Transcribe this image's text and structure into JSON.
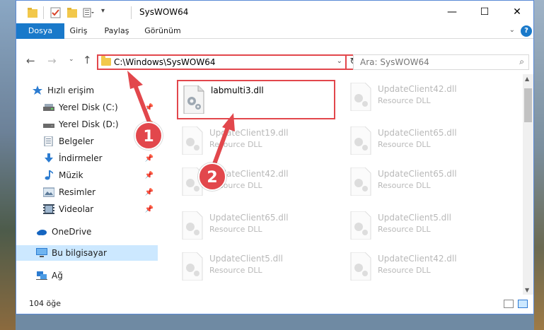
{
  "window": {
    "title": "SysWOW64"
  },
  "ribbon": {
    "tabs": [
      "Dosya",
      "Giriş",
      "Paylaş",
      "Görünüm"
    ],
    "help": "?"
  },
  "address": {
    "path": "C:\\Windows\\SysWOW64"
  },
  "search": {
    "placeholder": "Ara: SysWOW64"
  },
  "sidebar": {
    "items": [
      {
        "label": "Hızlı erişim",
        "icon": "star-icon"
      },
      {
        "label": "Yerel Disk (C:)",
        "icon": "drive-icon",
        "pinned": true
      },
      {
        "label": "Yerel Disk (D:)",
        "icon": "drive-icon",
        "pinned": true
      },
      {
        "label": "Belgeler",
        "icon": "documents-icon",
        "pinned": true
      },
      {
        "label": "İndirmeler",
        "icon": "download-icon",
        "pinned": true
      },
      {
        "label": "Müzik",
        "icon": "music-icon",
        "pinned": true
      },
      {
        "label": "Resimler",
        "icon": "pictures-icon",
        "pinned": true
      },
      {
        "label": "Videolar",
        "icon": "videos-icon",
        "pinned": true
      },
      {
        "label": "OneDrive",
        "icon": "cloud-icon"
      },
      {
        "label": "Bu bilgisayar",
        "icon": "computer-icon",
        "selected": true
      },
      {
        "label": "Ağ",
        "icon": "network-icon"
      }
    ]
  },
  "files": {
    "highlighted": {
      "name": "labmulti3.dll"
    },
    "left": [
      {
        "name": "UpdateClient19.dll",
        "type": "Resource DLL"
      },
      {
        "name": "UpdateClient42.dll",
        "type": "Resource DLL"
      },
      {
        "name": "UpdateClient65.dll",
        "type": "Resource DLL"
      },
      {
        "name": "UpdateClient5.dll",
        "type": "Resource DLL"
      }
    ],
    "right": [
      {
        "name": "UpdateClient42.dll",
        "type": "Resource DLL"
      },
      {
        "name": "UpdateClient65.dll",
        "type": "Resource DLL"
      },
      {
        "name": "UpdateClient65.dll",
        "type": "Resource DLL"
      },
      {
        "name": "UpdateClient5.dll",
        "type": "Resource DLL"
      },
      {
        "name": "UpdateClient42.dll",
        "type": "Resource DLL"
      }
    ]
  },
  "status": {
    "count": "104 öğe"
  },
  "annotations": {
    "step1": "1",
    "step2": "2"
  },
  "colors": {
    "accent": "#1979ca",
    "highlight": "#e2474c",
    "selected": "#cce8ff"
  }
}
